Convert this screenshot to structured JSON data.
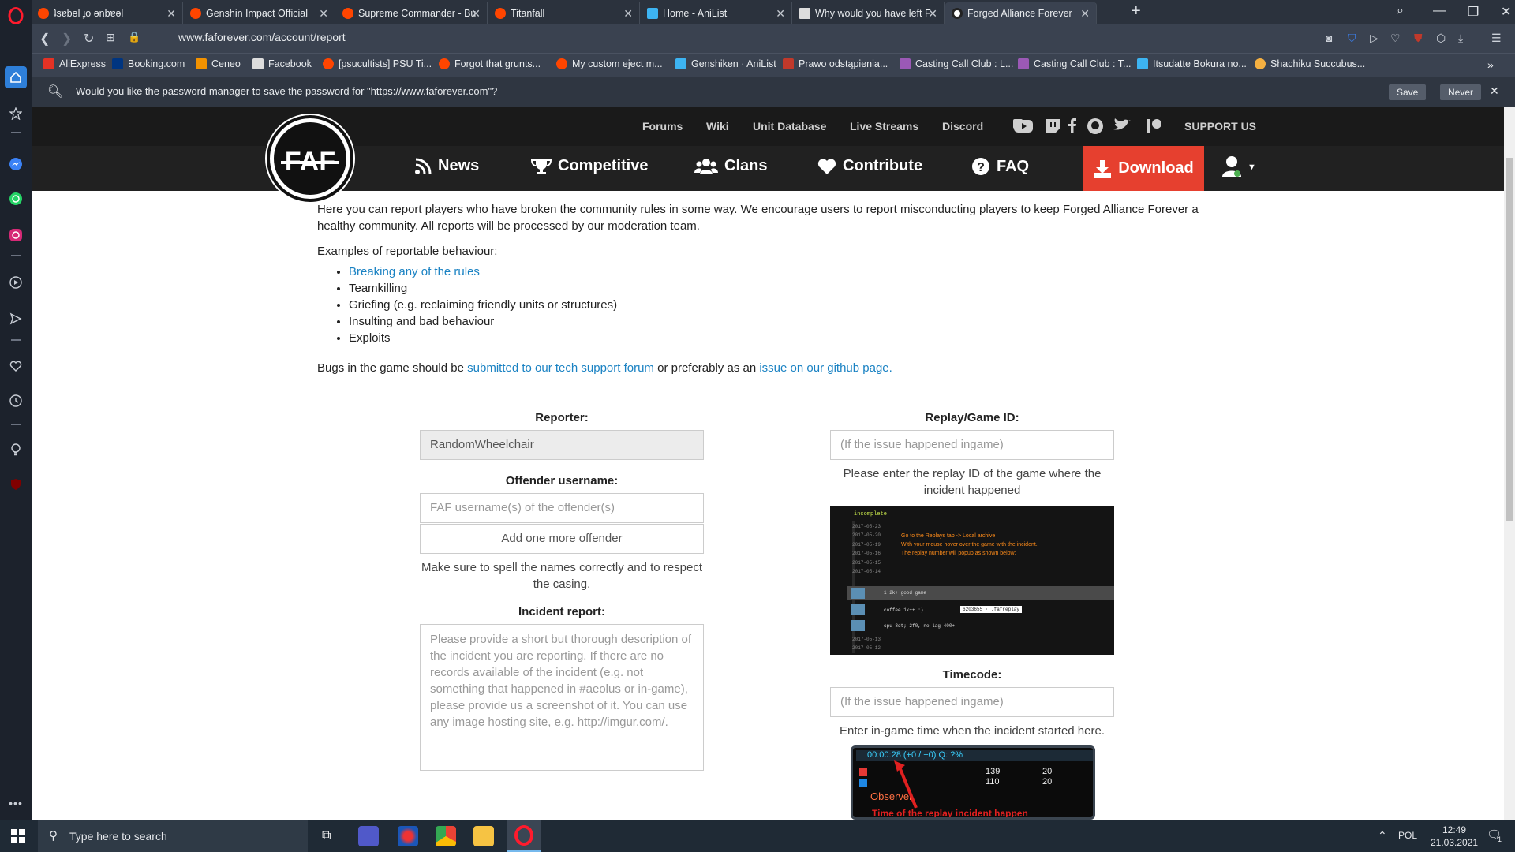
{
  "browser": {
    "tabs": [
      {
        "label": "ʇsɐbǝl ɟo ǝnbɐǝl",
        "color": "#ff4500"
      },
      {
        "label": "Genshin Impact Official",
        "color": "#ff4500"
      },
      {
        "label": "Supreme Commander - Bu",
        "color": "#ff4500"
      },
      {
        "label": "Titanfall",
        "color": "#ff4500"
      },
      {
        "label": "Home - AniList",
        "color": "#3db4f2"
      },
      {
        "label": "Why would you have left F",
        "color": "#dddddd"
      },
      {
        "label": "Forged Alliance Forever",
        "color": "#222222"
      }
    ],
    "url": "www.faforever.com/account/report",
    "bookmarks": [
      {
        "label": "AliExpress",
        "color": "#e43225"
      },
      {
        "label": "Booking.com",
        "color": "#003580"
      },
      {
        "label": "Ceneo",
        "color": "#f39200"
      },
      {
        "label": "Facebook",
        "color": "#dddddd"
      },
      {
        "label": "[psucultists] PSU Ti...",
        "color": "#ff4500"
      },
      {
        "label": "Forgot that grunts...",
        "color": "#ff4500"
      },
      {
        "label": "My custom eject m...",
        "color": "#ff4500"
      },
      {
        "label": "Genshiken · AniList",
        "color": "#3db4f2"
      },
      {
        "label": "Prawo odstąpienia...",
        "color": "#c0392b"
      },
      {
        "label": "Casting Call Club : L...",
        "color": "#9b59b6"
      },
      {
        "label": "Casting Call Club : T...",
        "color": "#9b59b6"
      },
      {
        "label": "Itsudatte Bokura no...",
        "color": "#3db4f2"
      },
      {
        "label": "Shachiku Succubus...",
        "color": "#f5b041"
      }
    ],
    "password_bar": {
      "text": "Would you like the password manager to save the password for \"https://www.faforever.com\"?",
      "save": "Save",
      "never": "Never"
    }
  },
  "site": {
    "logo": "FAF",
    "top_nav": [
      "Forums",
      "Wiki",
      "Unit Database",
      "Live Streams",
      "Discord",
      "SUPPORT US"
    ],
    "main_nav": [
      "News",
      "Competitive",
      "Clans",
      "Contribute",
      "FAQ"
    ],
    "download": "Download"
  },
  "page": {
    "intro": "Here you can report players who have broken the community rules in some way. We encourage users to report misconducting players to keep Forged Alliance Forever a healthy community. All reports will be processed by our moderation team.",
    "examples_title": "Examples of reportable behaviour:",
    "examples": [
      "Breaking any of the rules",
      "Teamkilling",
      "Griefing (e.g. reclaiming friendly units or structures)",
      "Insulting and bad behaviour",
      "Exploits"
    ],
    "bugs_prefix": "Bugs in the game should be ",
    "bugs_link1": "submitted to our tech support forum",
    "bugs_mid": " or preferably as an ",
    "bugs_link2": "issue on our github page."
  },
  "form": {
    "reporter_label": "Reporter:",
    "reporter_value": "RandomWheelchair",
    "offender_label": "Offender username:",
    "offender_placeholder": "FAF username(s) of the offender(s)",
    "add_offender": "Add one more offender",
    "offender_help": "Make sure to spell the names correctly and to respect the casing.",
    "incident_label": "Incident report:",
    "incident_placeholder": "Please provide a short but thorough description of the incident you are reporting. If there are no records available of the incident (e.g. not something that happened in #aeolus or in-game), please provide us a screenshot of it. You can use any image hosting site, e.g. http://imgur.com/.",
    "replay_label": "Replay/Game ID:",
    "replay_placeholder": "(If the issue happened ingame)",
    "replay_help": "Please enter the replay ID of the game where the incident happened",
    "replay_image": {
      "header": "incomplete",
      "dates": [
        "2017-05-23",
        "2017-05-20",
        "2017-05-19",
        "2017-05-16",
        "2017-05-15",
        "2017-05-14",
        "2017-05-13",
        "2017-05-12"
      ],
      "instructions": [
        "Go to the Replays tab -> Local archive",
        "With your mouse hover over the game with the incident.",
        "The replay number will popup as shown below:"
      ],
      "row1": "1.2k+ good game",
      "row2": "coffee 1k++ :)",
      "row2_tag": "6203655 · .fafreplay",
      "row3": "cpu 8dt; 2f0, no lag 400+"
    },
    "timecode_label": "Timecode:",
    "timecode_placeholder": "(If the issue happened ingame)",
    "timecode_help": "Enter in-game time when the incident started here.",
    "timecode_image": {
      "time": "00:00:28 (+0 / +0) Q: ?%",
      "n1": "139",
      "n2": "110",
      "v": "20",
      "observer": "Observer",
      "caption": "Time of the replay incident happen"
    }
  },
  "taskbar": {
    "search": "Type here to search",
    "lang": "POL",
    "time": "12:49",
    "date": "21.03.2021",
    "notif": "1"
  }
}
